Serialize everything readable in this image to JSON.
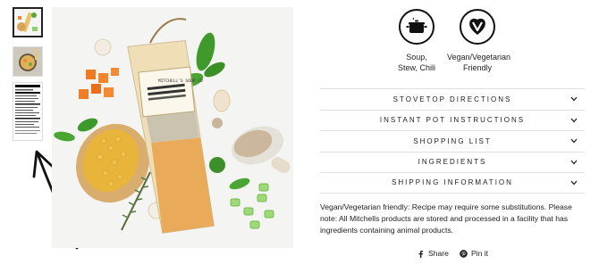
{
  "gallery": {
    "thumbnails": [
      "Product image 1",
      "Product image 2",
      "Product image 3"
    ]
  },
  "badges": [
    {
      "icon": "pot-icon",
      "label": "Soup,\nStew, Chili"
    },
    {
      "icon": "vegan-v-heart-icon",
      "label": "Vegan/Vegetarian\nFriendly"
    }
  ],
  "accordion": [
    {
      "label": "STOVETOP DIRECTIONS"
    },
    {
      "label": "INSTANT POT INSTRUCTIONS"
    },
    {
      "label": "SHOPPING LIST"
    },
    {
      "label": "INGREDIENTS"
    },
    {
      "label": "SHIPPING INFORMATION"
    }
  ],
  "description": "Vegan/Vegetarian friendly: Recipe may require some substitutions. Please note: All Mitchells products are stored and processed in a facility that has ingredients containing animal products.",
  "share": {
    "share_label": "Share",
    "pin_label": "Pin it"
  },
  "package": {
    "brand": "MITCHELL'S SOUP CO",
    "product_line1": "CLASSIC CHICKEN",
    "product_line2": "& HERB SOUP MIX"
  },
  "nutrition_thumb_title": "Nutrition Facts"
}
